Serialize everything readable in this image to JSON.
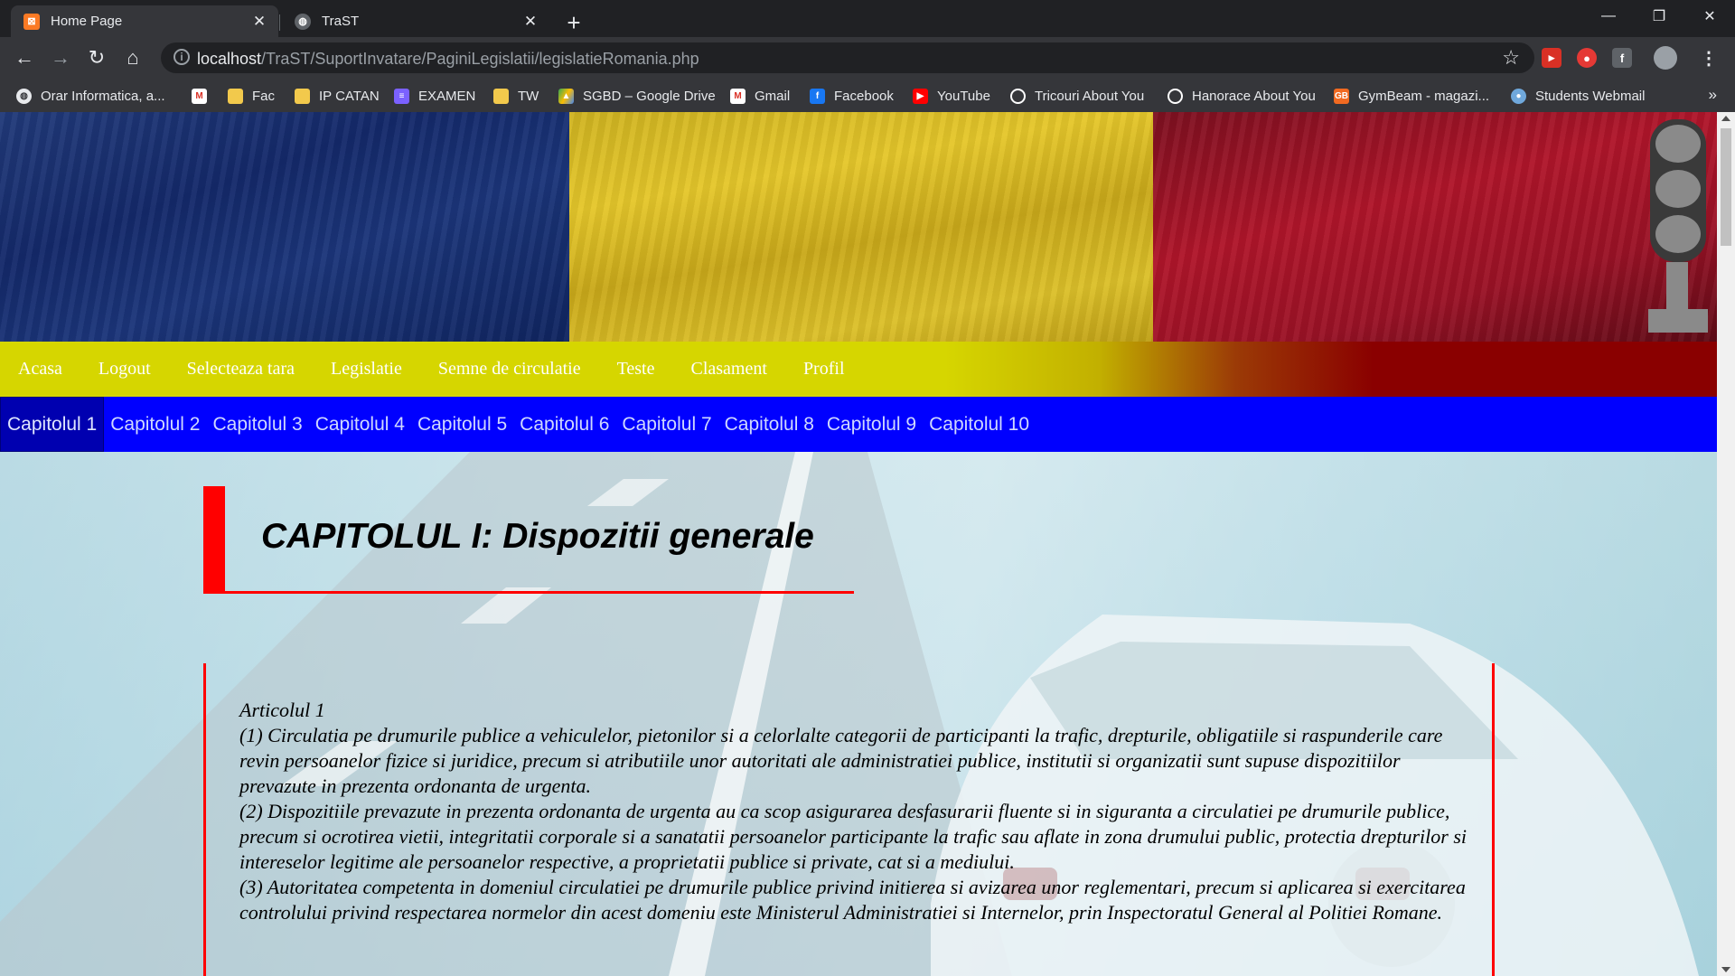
{
  "browser": {
    "tabs": [
      {
        "title": "Home Page",
        "favicon": "xampp-icon"
      },
      {
        "title": "TraST",
        "favicon": "globe-icon"
      }
    ],
    "url_host": "localhost",
    "url_path": "/TraST/SuportInvatare/PaginiLegislatii/legislatieRomania.php"
  },
  "bookmarks": [
    {
      "label": "Orar Informatica, a...",
      "icon": "globe-icon",
      "color": "#e8eaed"
    },
    {
      "label": "",
      "icon": "gmail-icon",
      "color": "#d93025"
    },
    {
      "label": "Fac",
      "icon": "folder-icon",
      "color": "#f2c94c"
    },
    {
      "label": "IP CATAN",
      "icon": "folder-icon",
      "color": "#f2c94c"
    },
    {
      "label": "EXAMEN",
      "icon": "list-icon",
      "color": "#7b61ff"
    },
    {
      "label": "TW",
      "icon": "folder-icon",
      "color": "#f2c94c"
    },
    {
      "label": "SGBD – Google Drive",
      "icon": "drive-icon",
      "color": "#34a853"
    },
    {
      "label": "Gmail",
      "icon": "gmail-icon",
      "color": "#d93025"
    },
    {
      "label": "Facebook",
      "icon": "facebook-icon",
      "color": "#1877f2"
    },
    {
      "label": "YouTube",
      "icon": "youtube-icon",
      "color": "#ff0000"
    },
    {
      "label": "Tricouri About You",
      "icon": "circle-icon",
      "color": "#ffffff"
    },
    {
      "label": "Hanorace About You",
      "icon": "circle-icon",
      "color": "#ffffff"
    },
    {
      "label": "GymBeam - magazi...",
      "icon": "gymbeam-icon",
      "color": "#f26a21"
    },
    {
      "label": "Students Webmail",
      "icon": "webmail-icon",
      "color": "#6fa8dc"
    }
  ],
  "nav": {
    "items": [
      "Acasa",
      "Logout",
      "Selecteaza tara",
      "Legislatie",
      "Semne de circulatie",
      "Teste",
      "Clasament",
      "Profil"
    ]
  },
  "chapters": [
    "Capitolul 1",
    "Capitolul 2",
    "Capitolul 3",
    "Capitolul 4",
    "Capitolul 5",
    "Capitolul 6",
    "Capitolul 7",
    "Capitolul 8",
    "Capitolul 9",
    "Capitolul 10"
  ],
  "content": {
    "chapter_title": "CAPITOLUL I: Dispozitii generale",
    "article_lines": [
      "Articolul 1",
      "(1) Circulatia pe drumurile publice a vehiculelor, pietonilor si a celorlalte categorii de participanti la trafic, drepturile, obligatiile si raspunderile care revin persoanelor fizice si juridice, precum si atributiile unor autoritati ale administratiei publice, institutii si organizatii sunt supuse dispozitiilor prevazute in prezenta ordonanta de urgenta.",
      "(2) Dispozitiile prevazute in prezenta ordonanta de urgenta au ca scop asigurarea desfasurarii fluente si in siguranta a circulatiei pe drumurile publice, precum si ocrotirea vietii, integritatii corporale si a sanatatii persoanelor participante la trafic sau aflate in zona drumului public, protectia drepturilor si intereselor legitime ale persoanelor respective, a proprietatii publice si private, cat si a mediului.",
      "(3) Autoritatea competenta in domeniul circulatiei pe drumurile publice privind initierea si avizarea unor reglementari, precum si aplicarea si exercitarea controlului privind respectarea normelor din acest domeniu este Ministerul Administratiei si Internelor, prin Inspectoratul General al Politiei Romane."
    ]
  },
  "colors": {
    "nav_yellow": "#d6d600",
    "nav_red": "#8a0000",
    "chapter_bar": "#0000ff",
    "accent_red": "#ff0000"
  }
}
